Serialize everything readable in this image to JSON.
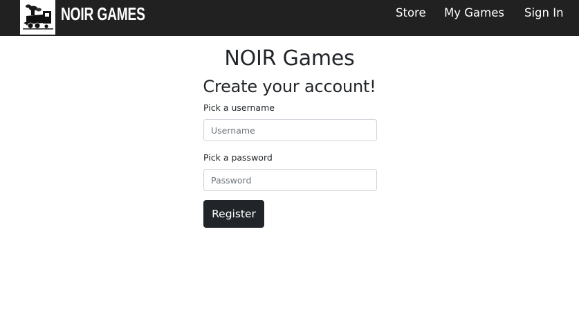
{
  "navbar": {
    "brand_name": "NOIR GAMES",
    "logo_icon": "train-icon",
    "links": [
      "Store",
      "My Games",
      "Sign In"
    ]
  },
  "main": {
    "site_title": "NOIR Games",
    "form_title": "Create your account!"
  },
  "form": {
    "username": {
      "label": "Pick a username",
      "placeholder": "Username",
      "value": ""
    },
    "password": {
      "label": "Pick a password",
      "placeholder": "Password",
      "value": ""
    },
    "submit_label": "Register"
  },
  "colors": {
    "navbar_bg": "#212121",
    "button_bg": "#212529",
    "text": "#212529"
  }
}
